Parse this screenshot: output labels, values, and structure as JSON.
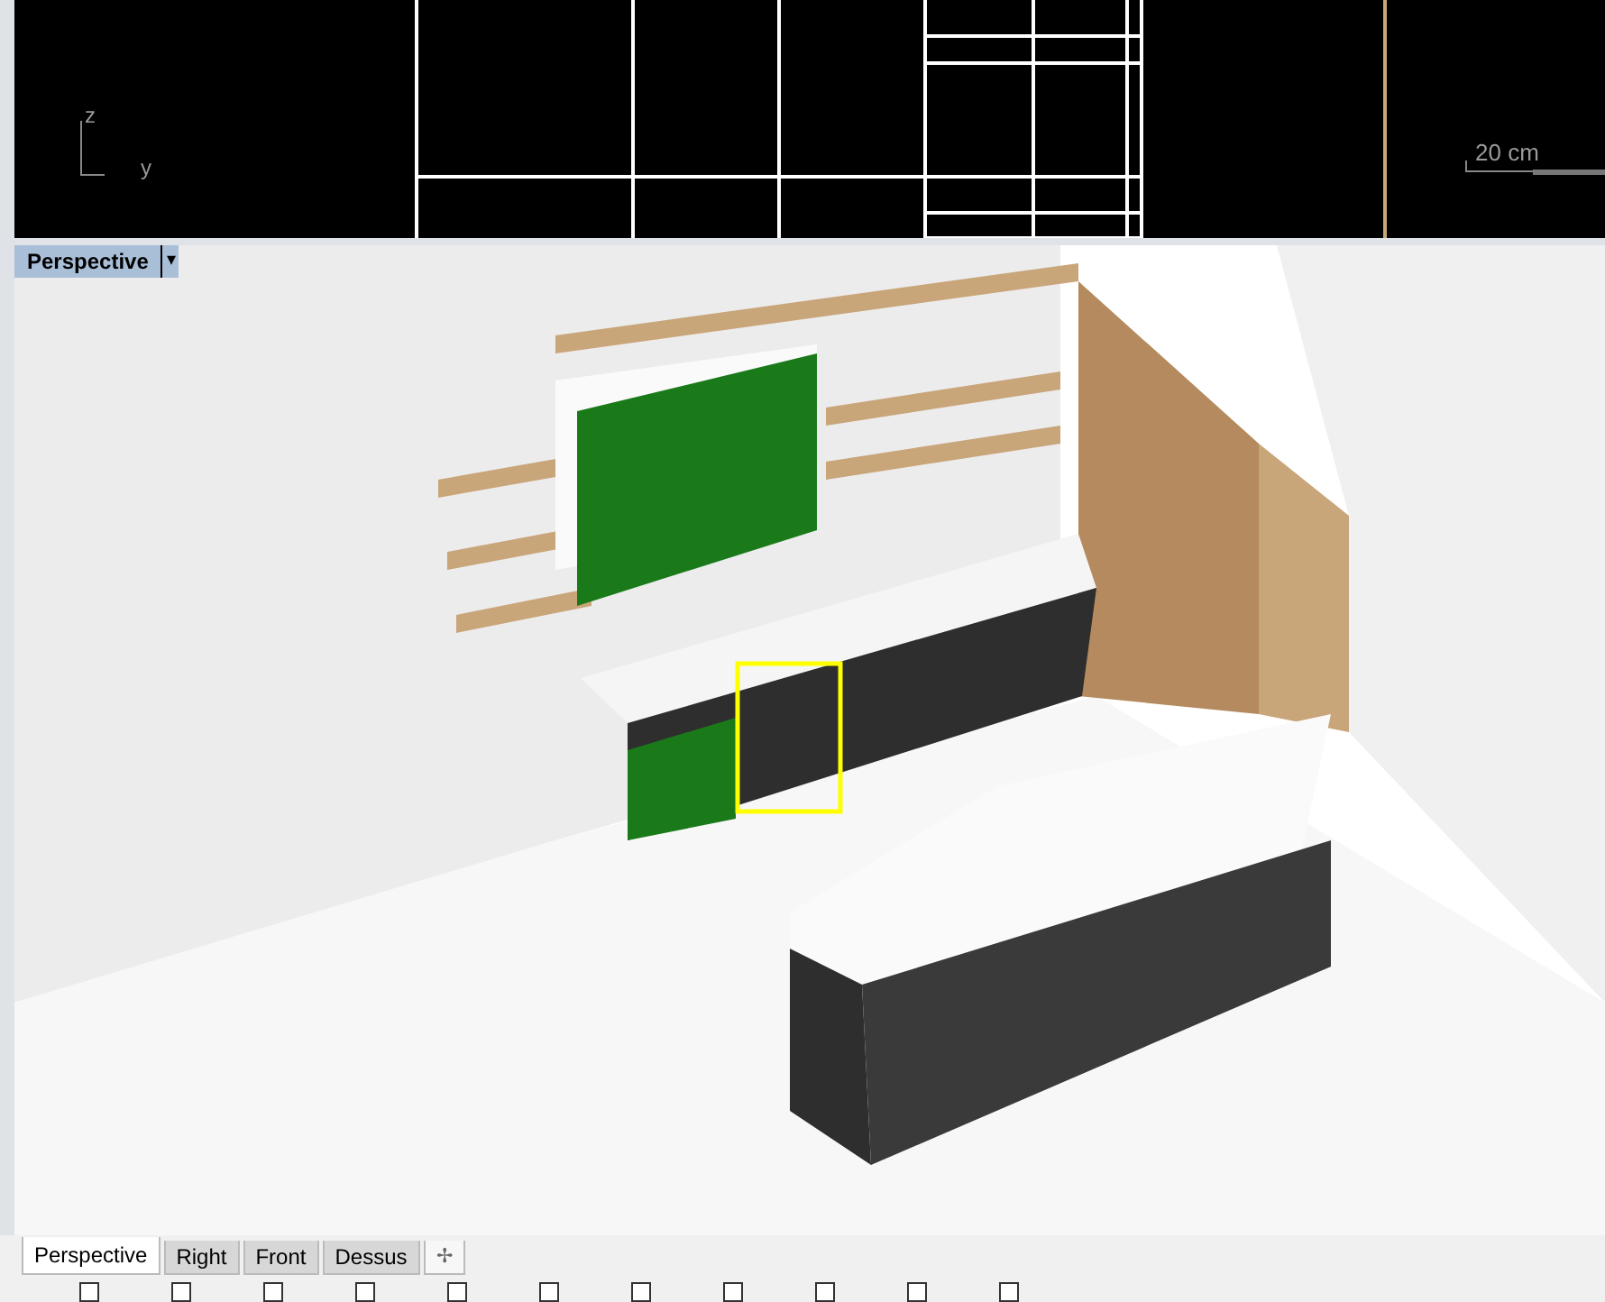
{
  "top_viewport": {
    "axis_labels": [
      "z",
      "y"
    ],
    "scale_label": "20 cm"
  },
  "perspective_viewport": {
    "title": "Perspective",
    "menu_glyph": "▾"
  },
  "viewport_tabs": [
    {
      "label": "Perspective",
      "selected": true
    },
    {
      "label": "Right",
      "selected": false
    },
    {
      "label": "Front",
      "selected": false
    },
    {
      "label": "Dessus",
      "selected": false
    }
  ],
  "add_tab_glyph": "✢",
  "osnap_checkboxes": [
    {
      "checked": false
    },
    {
      "checked": false
    },
    {
      "checked": false
    },
    {
      "checked": false
    },
    {
      "checked": false
    },
    {
      "checked": false
    },
    {
      "checked": false
    },
    {
      "checked": false
    },
    {
      "checked": false
    },
    {
      "checked": false
    },
    {
      "checked": false
    }
  ]
}
